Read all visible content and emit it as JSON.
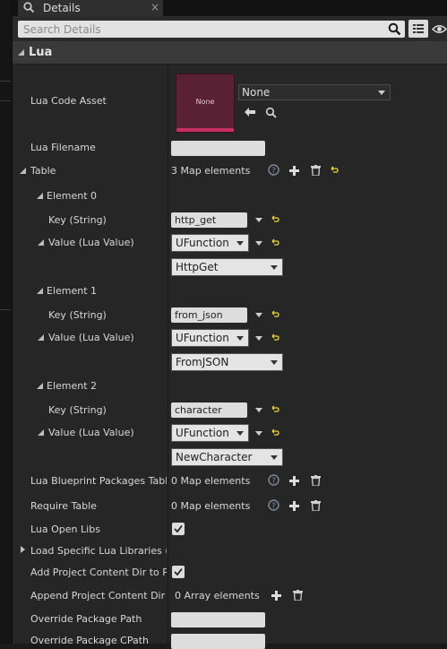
{
  "tab": {
    "title": "Details",
    "close": "×"
  },
  "search": {
    "placeholder": "Search Details",
    "value": ""
  },
  "category": {
    "title": "Lua"
  },
  "lua_code_asset": {
    "label": "Lua Code Asset",
    "thumbnail_text": "None",
    "selected": "None"
  },
  "lua_filename": {
    "label": "Lua Filename",
    "value": ""
  },
  "table": {
    "label": "Table",
    "summary": "3 Map elements",
    "elements": [
      {
        "label": "Element 0",
        "key_label": "Key (String)",
        "key": "http_get",
        "value_label": "Value (Lua Value)",
        "value_type": "UFunction",
        "function": "HttpGet"
      },
      {
        "label": "Element 1",
        "key_label": "Key (String)",
        "key": "from_json",
        "value_label": "Value (Lua Value)",
        "value_type": "UFunction",
        "function": "FromJSON"
      },
      {
        "label": "Element 2",
        "key_label": "Key (String)",
        "key": "character",
        "value_label": "Value (Lua Value)",
        "value_type": "UFunction",
        "function": "NewCharacter"
      }
    ]
  },
  "bp_packages": {
    "label": "Lua Blueprint Packages Table",
    "summary": "0 Map elements"
  },
  "require_table": {
    "label": "Require Table",
    "summary": "0 Map elements"
  },
  "open_libs": {
    "label": "Lua Open Libs",
    "checked": true
  },
  "load_specific": {
    "label": "Load Specific Lua Libraries (or"
  },
  "add_content_dir": {
    "label": "Add Project Content Dir to Pac",
    "checked": true
  },
  "append_content_dir": {
    "label": "Append Project Content Dir Sul",
    "summary": "0 Array elements"
  },
  "override_path": {
    "label": "Override Package Path",
    "value": ""
  },
  "override_cpath": {
    "label": "Override Package CPath",
    "value": ""
  },
  "colors": {
    "accent_pink": "#c9305d",
    "thumb_bg": "#5a2033",
    "reset_yellow": "#e8d63a"
  }
}
